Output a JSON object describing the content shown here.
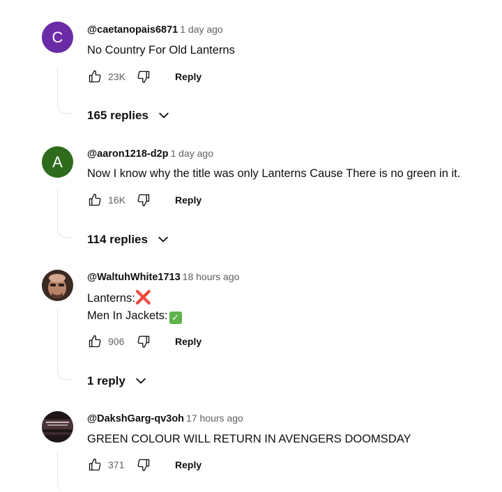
{
  "comments": [
    {
      "author": "@caetanopais6871",
      "time": "1 day ago",
      "text": "No Country For Old Lanterns",
      "likes": "23K",
      "reply_label": "Reply",
      "replies_label": "165 replies",
      "avatar_letter": "C",
      "avatar_color": "#6b2ba6"
    },
    {
      "author": "@aaron1218-d2p",
      "time": "1 day ago",
      "text": "Now I know why the title was only Lanterns Cause There is no green in it.",
      "likes": "16K",
      "reply_label": "Reply",
      "replies_label": "114 replies",
      "avatar_letter": "A",
      "avatar_color": "#2e6b1c"
    },
    {
      "author": "@WaltuhWhite1713",
      "time": "18 hours ago",
      "text_line1": "Lanterns:",
      "text_line1_emoji": "❌",
      "text_line2": "Men In Jackets:",
      "text_line2_emoji": "✓",
      "likes": "906",
      "reply_label": "Reply",
      "replies_label": "1 reply"
    },
    {
      "author": "@DakshGarg-qv3oh",
      "time": "17 hours ago",
      "text": "GREEN COLOUR WILL RETURN IN AVENGERS DOOMSDAY",
      "likes": "371",
      "reply_label": "Reply"
    }
  ]
}
